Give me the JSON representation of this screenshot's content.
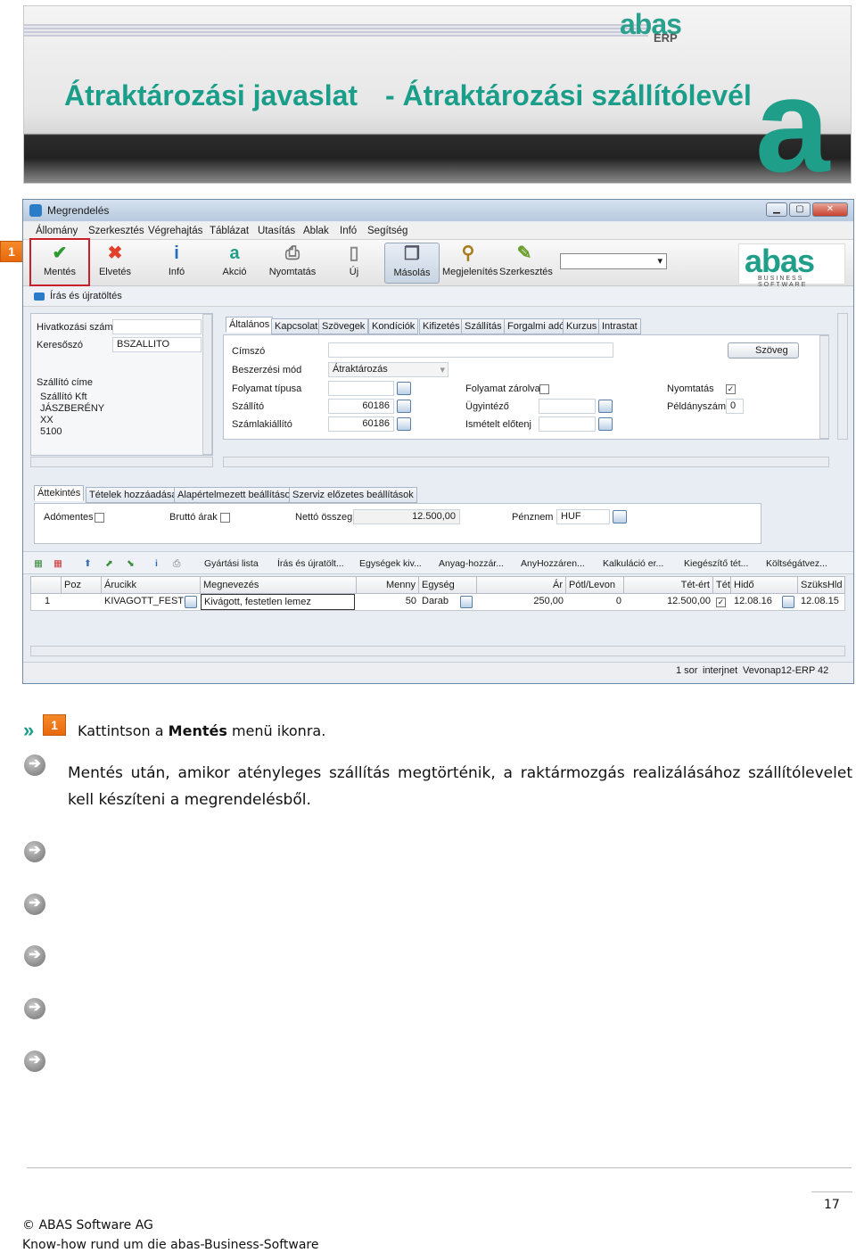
{
  "banner": {
    "title_left": "Átraktározási javaslat",
    "title_right": "- Átraktározási szállítólevél",
    "logo_text": "abas",
    "logo_sub": "ERP"
  },
  "window": {
    "title": "Megrendelés",
    "menu": [
      "Állomány",
      "Szerkesztés",
      "Végrehajtás",
      "Táblázat",
      "Utasítás",
      "Ablak",
      "Infó",
      "Segítség"
    ],
    "toolbar": [
      {
        "label": "Mentés",
        "icon": "check-icon"
      },
      {
        "label": "Elvetés",
        "icon": "x-icon"
      },
      {
        "label": "Infó",
        "icon": "info-icon"
      },
      {
        "label": "Akció",
        "icon": "action-icon"
      },
      {
        "label": "Nyomtatás",
        "icon": "printer-icon"
      },
      {
        "label": "Új",
        "icon": "new-doc-icon"
      },
      {
        "label": "Másolás",
        "icon": "copy-icon"
      },
      {
        "label": "Megjelenítés",
        "icon": "magnifier-icon"
      },
      {
        "label": "Szerkesztés",
        "icon": "edit-icon"
      }
    ],
    "logo": "abas",
    "logo_sub": "BUSINESS SOFTWARE",
    "reload": "Írás és újratöltés",
    "left": {
      "hivatkozasi_szam_label": "Hivatkozási szám",
      "hivatkozasi_szam": "",
      "keresoszo_label": "Keresőszó",
      "keresoszo": "BSZALLITO",
      "szallito_cime_label": "Szállító címe",
      "address": [
        "Szállító Kft",
        "JÁSZBERÉNY",
        "XX",
        "5100"
      ]
    },
    "tabs": [
      "Általános",
      "Kapcsolat",
      "Szövegek",
      "Kondíciók",
      "Kifizetés",
      "Szállítás",
      "Forgalmi adó",
      "Kurzus",
      "Intrastat"
    ],
    "form": {
      "cimszo_label": "Címszó",
      "cimszo": "",
      "beszerzesi_mod_label": "Beszerzési mód",
      "beszerzesi_mod": "Átraktározás",
      "folyamat_tipusa_label": "Folyamat típusa",
      "folyamat_tipusa": "",
      "szallito_label": "Szállító",
      "szallito": "60186",
      "szamlaliallito_label": "Számlakiállító",
      "szamlaliallito": "60186",
      "szoveg_button": "Szöveg",
      "folyamat_zarolva_label": "Folyamat zárolva",
      "folyamat_zarolva": false,
      "ugyintezo_label": "Ügyintéző",
      "ugyintezo": "",
      "ismetelt_elotenj_label": "Ismételt előtenj",
      "ismetelt_elotenj": "",
      "nyomtatas_label": "Nyomtatás",
      "nyomtatas": true,
      "peldanyszam_label": "Példányszám",
      "peldanyszam": "0"
    },
    "tabs2": [
      "Áttekintés",
      "Tételek hozzáadása",
      "Alapértelmezett beállítások",
      "Szerviz előzetes beállítások"
    ],
    "summary": {
      "adomentes_label": "Adómentes",
      "brutto_label": "Bruttó árak",
      "netto_label": "Nettó összeg",
      "netto": "12.500,00",
      "penznem_label": "Pénznem",
      "penznem": "HUF"
    },
    "grid_toolbar": [
      "Gyártási lista",
      "Írás és újratölt...",
      "Egységek kiv...",
      "Anyag-hozzár...",
      "AnyHozzáren...",
      "Kalkuláció er...",
      "Kiegészítő tét...",
      "Költségátvez..."
    ],
    "grid_headers": [
      "Poz",
      "Árucikk",
      "Megnevezés",
      "Menny",
      "Egység",
      "Ár",
      "Pótl/Levon",
      "Tét-ért",
      "Tét",
      "Hidő",
      "SzüksHld"
    ],
    "grid_row": {
      "poz": "1",
      "arucikk": "KIVAGOTT_FESTE",
      "megnevezes": "Kivágott, festetlen lemez",
      "menny": "50",
      "egyseg": "Darab",
      "ar": "250,00",
      "potl": "0",
      "tet_ert": "12.500,00",
      "hido": "12.08.16",
      "szukshld": "12.08.15"
    },
    "status": {
      "rows": "1 sor",
      "mode": "interjnet",
      "user": "Vevonap12-ERP",
      "num": "42"
    }
  },
  "step_marker": "1",
  "instruction": {
    "prefix": "Kattintson a",
    "bold": "Mentés",
    "suffix": "menü ikonra."
  },
  "body_text": "Mentés után, amikor atényleges szállítás megtörténik, a raktármozgás realizálásához szállítólevelet kell készíteni a megrendelésből.",
  "page_number": "17",
  "footer": {
    "copyright": "© ABAS Software AG",
    "tagline": "Know-how rund um die abas-Business-Software"
  }
}
